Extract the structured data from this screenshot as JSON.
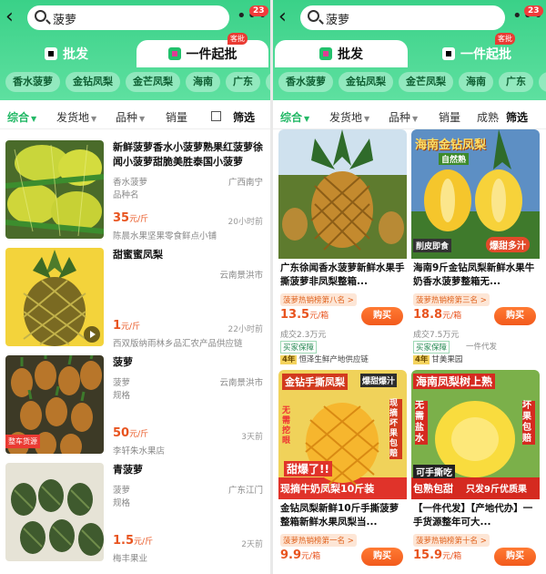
{
  "search": {
    "query": "菠萝",
    "badge": "23"
  },
  "mode_tabs": {
    "wholesale": "批发",
    "single": "一件起批",
    "new_tag": "客批"
  },
  "chips": [
    "香水菠萝",
    "金钻凤梨",
    "金芒凤梨",
    "海南",
    "广东",
    "云"
  ],
  "filters": {
    "all": "综合",
    "origin": "发货地",
    "variety": "品种",
    "sales": "销量",
    "sales_partial": "成熟",
    "filter": "筛选"
  },
  "left_list": [
    {
      "title": "新鲜菠萝香水小菠萝熟果红菠萝徐闻小菠萝甜脆美胜泰国小菠萝",
      "meta1": "香水菠萝",
      "meta2": "品种名",
      "location": "广西南宁",
      "price": "35",
      "unit": "元/斤",
      "time": "20小时前",
      "shop": "陈晨水果坚果零食鲜点小铺"
    },
    {
      "title": "甜蜜蜜凤梨",
      "meta1": "",
      "meta2": "",
      "location": "云南景洪市",
      "price": "1",
      "unit": "元/斤",
      "time": "22小时前",
      "shop": "西双版纳雨林乡品汇农产品供应链"
    },
    {
      "title": "菠萝",
      "meta1": "菠萝",
      "meta2": "规格",
      "location": "云南景洪市",
      "price": "50",
      "unit": "元/斤",
      "time": "3天前",
      "shop": "李轩朱水果店",
      "tag": "整车货源"
    },
    {
      "title": "青菠萝",
      "meta1": "菠萝",
      "meta2": "规格",
      "location": "广东江门",
      "price": "1.5",
      "unit": "元/斤",
      "time": "2天前",
      "shop": "梅丰果业"
    }
  ],
  "cards": [
    {
      "title": "广东徐闻香水菠萝新鲜水果手撕菠萝非凤梨整箱...",
      "rank": "菠萝热销榜第八名 >",
      "price": "13.5",
      "unit": "元/箱",
      "buy": "购买",
      "sold": "成交2.3万元",
      "guarantee": "买家保障",
      "years": "4年",
      "supplier": "恒泽生鲜产地供应链"
    },
    {
      "title": "海南9斤金钻凤梨新鲜水果牛奶香水菠萝整箱无...",
      "rank": "菠萝热销榜第三名 >",
      "price": "18.8",
      "unit": "元/箱",
      "buy": "购买",
      "sold": "成交7.5万元",
      "guarantee": "买家保障",
      "guarantee2": "一件代发",
      "years": "4年",
      "supplier": "甘美果园",
      "overlay": [
        "海南金钻凤梨",
        "自然熟",
        "削皮即食",
        "爆甜多汁"
      ]
    },
    {
      "title": "金钻凤梨新鲜10斤手撕菠萝整箱新鲜水果凤梨当...",
      "rank": "菠萝热销榜第一名 >",
      "price": "9.9",
      "unit": "元/箱",
      "buy": "购买",
      "overlay": [
        "金钻手撕凤梨",
        "爆甜爆汁",
        "无需挖眼",
        "现摘坏果包赔",
        "甜爆了!!",
        "现摘牛奶凤梨10斤装"
      ]
    },
    {
      "title": "【一件代发】【产地代办】一手货源整年可大...",
      "rank": "菠萝热销榜第十名 >",
      "price": "15.9",
      "unit": "元/箱",
      "buy": "购买",
      "overlay": [
        "海南凤梨树上熟",
        "无需盐水",
        "坏果包赔",
        "可手撕吃",
        "包熟包甜",
        "只发9斤优质果"
      ]
    }
  ],
  "colors": {
    "brand_green": "#3ad188",
    "price_orange": "#e8541f",
    "badge_red": "#f23b3b"
  }
}
